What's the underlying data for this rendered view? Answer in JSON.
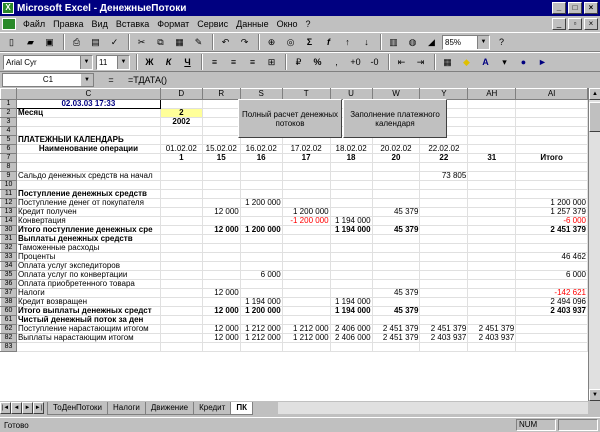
{
  "window": {
    "title": "Microsoft Excel - ДенежныеПотоки"
  },
  "menu": [
    "Файл",
    "Правка",
    "Вид",
    "Вставка",
    "Формат",
    "Сервис",
    "Данные",
    "Окно",
    "?"
  ],
  "toolbar": {
    "zoom": "85%",
    "font": "Arial Cyr",
    "size": "11"
  },
  "formula_bar": {
    "cell_ref": "C1",
    "eq": "=",
    "formula": "=ТДАТА()"
  },
  "columns": [
    "",
    "C",
    "D",
    "R",
    "S",
    "T",
    "U",
    "W",
    "Y",
    "AH",
    "AI"
  ],
  "cells": {
    "datetime": "02.03.03 17:33",
    "month_label": "Месяц",
    "month_value": "2",
    "year_value": "2002",
    "btn_full_calc": "Полный расчет денежных потоков",
    "btn_fill_calendar": "Заполнение платежного календаря",
    "calendar_title": "ПЛАТЕЖНЫЙ КАЛЕНДАРЬ",
    "op_name_header": "Наименование операции",
    "total_header": "Итого"
  },
  "date_headers": [
    "01.02.02",
    "15.02.02",
    "16.02.02",
    "17.02.02",
    "18.02.02",
    "20.02.02",
    "22.02.02",
    ""
  ],
  "day_headers": [
    "1",
    "15",
    "16",
    "17",
    "18",
    "20",
    "22",
    "31"
  ],
  "rows": [
    {
      "n": "8",
      "label": "",
      "vals": [
        "",
        "",
        "",
        "",
        "",
        "",
        "",
        "",
        ""
      ],
      "style": ""
    },
    {
      "n": "9",
      "label": "Сальдо денежных средств на начал",
      "vals": [
        "",
        "",
        "",
        "",
        "",
        "",
        "73 805",
        "",
        ""
      ],
      "style": ""
    },
    {
      "n": "10",
      "label": "",
      "vals": [
        "",
        "",
        "",
        "",
        "",
        "",
        "",
        "",
        ""
      ],
      "style": ""
    },
    {
      "n": "11",
      "label": "Поступление денежных средств",
      "vals": [
        "",
        "",
        "",
        "",
        "",
        "",
        "",
        "",
        ""
      ],
      "style": "bold"
    },
    {
      "n": "12",
      "label": "Поступление денег от покупателя",
      "vals": [
        "",
        "",
        "1 200 000",
        "",
        "",
        "",
        "",
        "",
        "1 200 000"
      ],
      "style": ""
    },
    {
      "n": "13",
      "label": "Кредит получен",
      "vals": [
        "",
        "12 000",
        "",
        "1 200 000",
        "",
        "45 379",
        "",
        "",
        "1 257 379"
      ],
      "style": ""
    },
    {
      "n": "14",
      "label": "Конвертация",
      "vals": [
        "",
        "",
        "",
        "-1 200 000",
        "1 194 000",
        "",
        "",
        "",
        "-6 000"
      ],
      "style": "",
      "red": [
        3,
        8
      ]
    },
    {
      "n": "30",
      "label": "Итого поступление денежных сре",
      "vals": [
        "",
        "12 000",
        "1 200 000",
        "",
        "1 194 000",
        "45 379",
        "",
        "",
        "2 451 379"
      ],
      "style": "bold"
    },
    {
      "n": "31",
      "label": "Выплаты денежных средств",
      "vals": [
        "",
        "",
        "",
        "",
        "",
        "",
        "",
        "",
        ""
      ],
      "style": "bold"
    },
    {
      "n": "32",
      "label": "Таможенные расходы",
      "vals": [
        "",
        "",
        "",
        "",
        "",
        "",
        "",
        "",
        ""
      ],
      "style": ""
    },
    {
      "n": "33",
      "label": "Проценты",
      "vals": [
        "",
        "",
        "",
        "",
        "",
        "",
        "",
        "",
        "46 462"
      ],
      "style": ""
    },
    {
      "n": "34",
      "label": "Оплата услуг экспедиторов",
      "vals": [
        "",
        "",
        "",
        "",
        "",
        "",
        "",
        "",
        ""
      ],
      "style": ""
    },
    {
      "n": "35",
      "label": "Оплата услуг по конвертации",
      "vals": [
        "",
        "",
        "6 000",
        "",
        "",
        "",
        "",
        "",
        "6 000"
      ],
      "style": ""
    },
    {
      "n": "36",
      "label": "Оплата приобретенного товара",
      "vals": [
        "",
        "",
        "",
        "",
        "",
        "",
        "",
        "",
        ""
      ],
      "style": ""
    },
    {
      "n": "37",
      "label": "Налоги",
      "vals": [
        "",
        "12 000",
        "",
        "",
        "",
        "45 379",
        "",
        "",
        "-142 621"
      ],
      "style": "",
      "red": [
        8
      ]
    },
    {
      "n": "38",
      "label": "Кредит возвращен",
      "vals": [
        "",
        "",
        "1 194 000",
        "",
        "1 194 000",
        "",
        "",
        "",
        "2 494 096"
      ],
      "style": ""
    },
    {
      "n": "60",
      "label": "Итого выплаты денежных средст",
      "vals": [
        "",
        "12 000",
        "1 200 000",
        "",
        "1 194 000",
        "45 379",
        "",
        "",
        "2 403 937"
      ],
      "style": "bold"
    },
    {
      "n": "61",
      "label": "Чистый денежный поток за ден",
      "vals": [
        "",
        "",
        "",
        "",
        "",
        "",
        "",
        "",
        ""
      ],
      "style": "bold italic"
    },
    {
      "n": "62",
      "label": "Поступление нарастающим итогом",
      "vals": [
        "",
        "12 000",
        "1 212 000",
        "1 212 000",
        "2 406 000",
        "2 451 379",
        "2 451 379",
        "2 451 379",
        ""
      ],
      "style": ""
    },
    {
      "n": "82",
      "label": "Выплаты нарастающим итогом",
      "vals": [
        "",
        "12 000",
        "1 212 000",
        "1 212 000",
        "2 406 000",
        "2 451 379",
        "2 403 937",
        "2 403 937",
        ""
      ],
      "style": ""
    },
    {
      "n": "83",
      "label": "",
      "vals": [
        "",
        "",
        "",
        "",
        "",
        "",
        "",
        "",
        ""
      ],
      "style": ""
    }
  ],
  "sheet_tabs": [
    "ТоДенПотоки",
    "Налоги",
    "Движение",
    "Кредит",
    "ПК"
  ],
  "active_tab": "ПК",
  "status": {
    "ready": "Готово",
    "num": "NUM"
  }
}
